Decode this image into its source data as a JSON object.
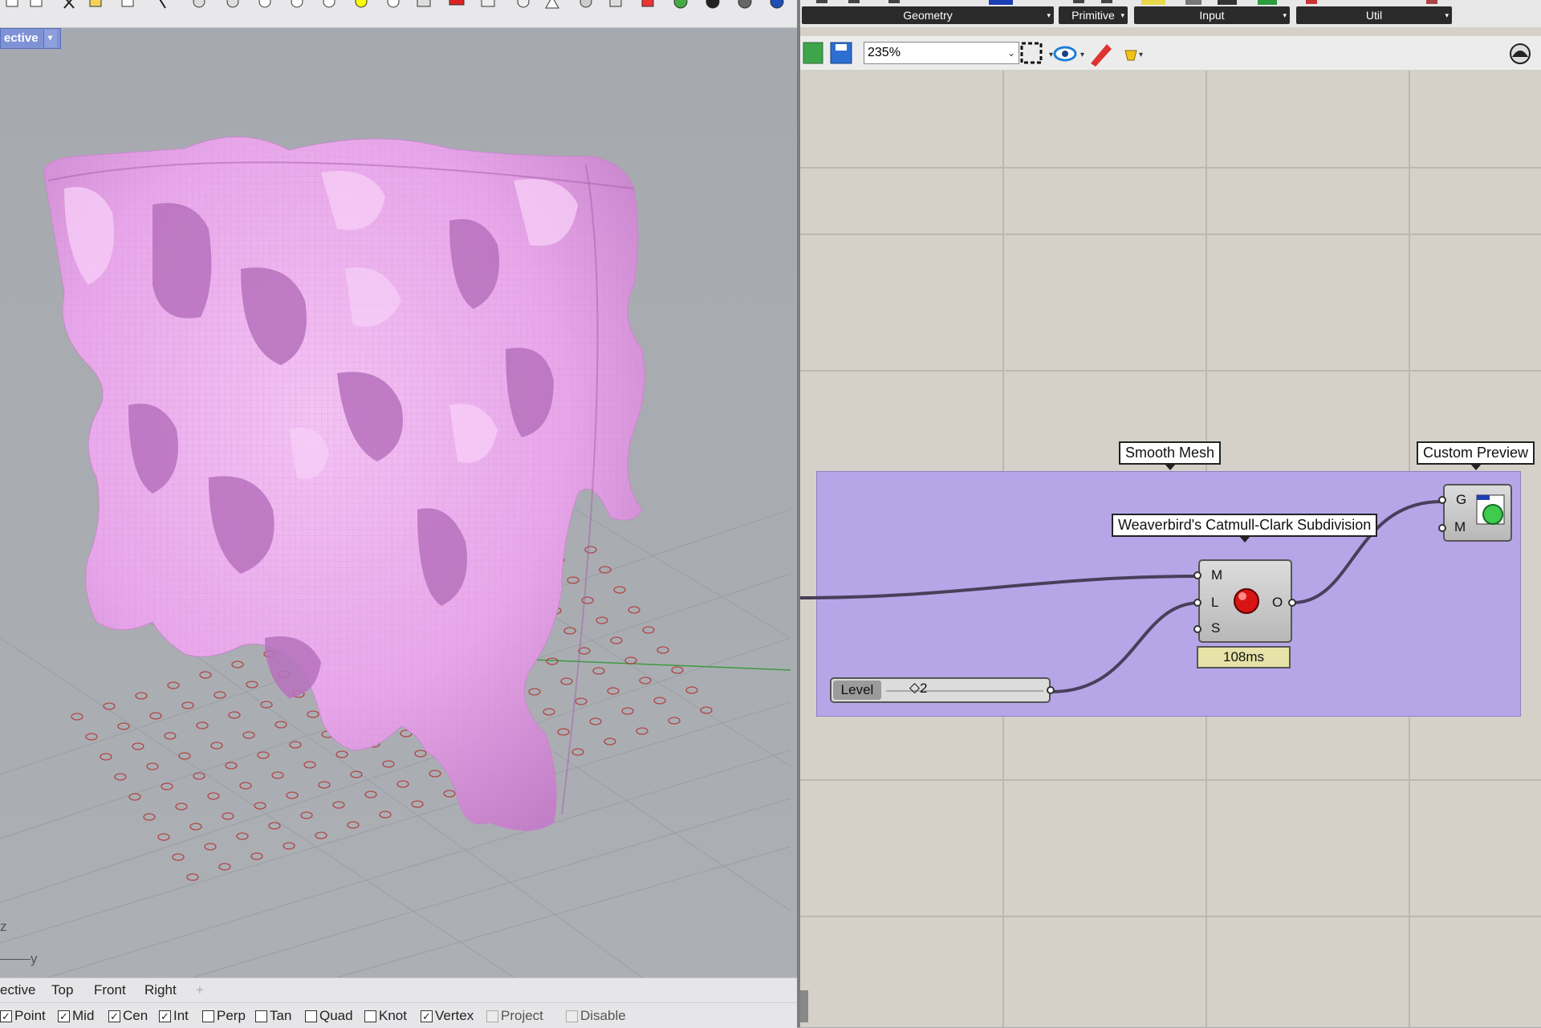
{
  "rhino": {
    "viewport_title": "ective",
    "view_tabs": [
      "ective",
      "Top",
      "Front",
      "Right"
    ],
    "add_tab": "+",
    "axis": {
      "z": "z",
      "y": "y"
    },
    "osnaps": [
      {
        "label": "Point",
        "checked": true
      },
      {
        "label": "Mid",
        "checked": true
      },
      {
        "label": "Cen",
        "checked": true
      },
      {
        "label": "Int",
        "checked": true
      },
      {
        "label": "Perp",
        "checked": false
      },
      {
        "label": "Tan",
        "checked": false
      },
      {
        "label": "Quad",
        "checked": false
      },
      {
        "label": "Knot",
        "checked": false
      },
      {
        "label": "Vertex",
        "checked": true
      },
      {
        "label": "Project",
        "checked": false,
        "disabled": true
      },
      {
        "label": "Disable",
        "checked": false,
        "disabled": true
      }
    ],
    "mesh_color": "#efaaf0"
  },
  "grasshopper": {
    "ribbon": [
      "Geometry",
      "Primitive",
      "Input",
      "Util"
    ],
    "zoom": "235%",
    "group_color": "#b6a6e8",
    "canvas_color": "#d5d1c9",
    "labels": {
      "smooth_mesh": "Smooth Mesh",
      "custom_preview": "Custom Preview",
      "catmull": "Weaverbird's Catmull-Clark Subdivision"
    },
    "catmull_inputs": [
      "M",
      "L",
      "S"
    ],
    "catmull_output": "O",
    "timer": "108ms",
    "preview_inputs": [
      "G",
      "M"
    ],
    "slider": {
      "label": "Level",
      "value": "2"
    }
  }
}
